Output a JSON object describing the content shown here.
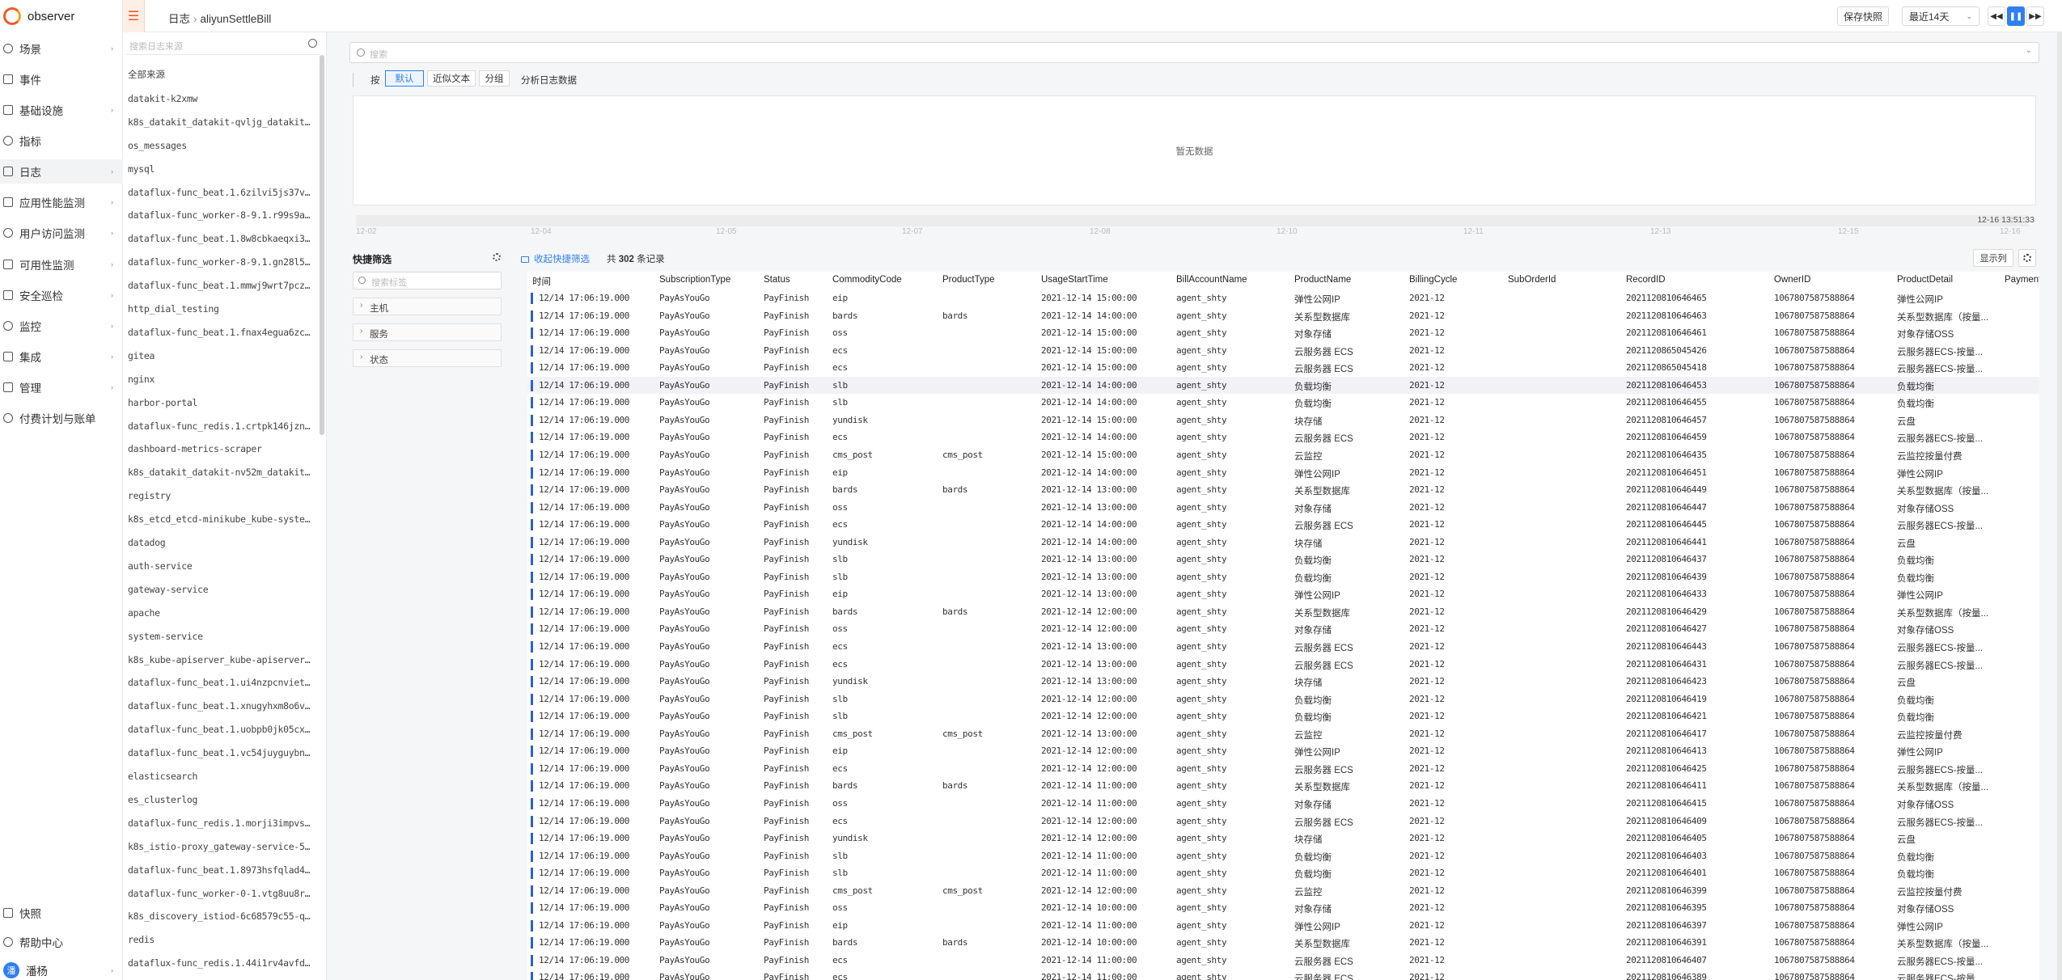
{
  "app": {
    "name": "observer"
  },
  "nav": {
    "items": [
      {
        "label": "场景",
        "arrow": true
      },
      {
        "label": "事件",
        "arrow": false
      },
      {
        "label": "基础设施",
        "arrow": true
      },
      {
        "label": "指标",
        "arrow": false
      },
      {
        "label": "日志",
        "arrow": true
      },
      {
        "label": "应用性能监测",
        "arrow": true
      },
      {
        "label": "用户访问监测",
        "arrow": true
      },
      {
        "label": "可用性监测",
        "arrow": true
      },
      {
        "label": "安全巡检",
        "arrow": true
      },
      {
        "label": "监控",
        "arrow": true
      },
      {
        "label": "集成",
        "arrow": true
      },
      {
        "label": "管理",
        "arrow": true
      },
      {
        "label": "付费计划与账单",
        "arrow": false
      }
    ],
    "bottom": [
      {
        "label": "快照"
      },
      {
        "label": "帮助中心"
      }
    ],
    "user": {
      "avatar": "潘",
      "name": "潘杨"
    }
  },
  "topbar": {
    "breadcrumb": [
      "日志",
      "aliyunSettleBill"
    ],
    "save_snapshot": "保存快照",
    "time_range": "最近14天"
  },
  "sources": {
    "search_placeholder": "搜索日志来源",
    "items": [
      "全部来源",
      "datakit-k2xmw",
      "k8s_datakit_datakit-qvljg_datakit_...",
      "os_messages",
      "mysql",
      "dataflux-func_beat.1.6zilvi5js37vg...",
      "dataflux-func_worker-8-9.1.r99s9a3...",
      "dataflux-func_beat.1.8w8cbkaeqxi37...",
      "dataflux-func_worker-8-9.1.gn28l5u...",
      "dataflux-func_beat.1.mmwj9wrt7pczl...",
      "http_dial_testing",
      "dataflux-func_beat.1.fnax4egua6zcw...",
      "gitea",
      "nginx",
      "harbor-portal",
      "dataflux-func_redis.1.crtpk146jzny...",
      "dashboard-metrics-scraper",
      "k8s_datakit_datakit-nv52m_datakit_...",
      "registry",
      "k8s_etcd_etcd-minikube_kube-system...",
      "datadog",
      "auth-service",
      "gateway-service",
      "apache",
      "system-service",
      "k8s_kube-apiserver_kube-apiserver-...",
      "dataflux-func_beat.1.ui4nzpcnvieth...",
      "dataflux-func_beat.1.xnugyhxm8o6vr...",
      "dataflux-func_beat.1.uobpb0jk05cx1...",
      "dataflux-func_beat.1.vc54juyguybne...",
      "elasticsearch",
      "es_clusterlog",
      "dataflux-func_redis.1.morji3impvsw...",
      "k8s_istio-proxy_gateway-service-59...",
      "dataflux-func_beat.1.8973hsfqlad4c...",
      "dataflux-func_worker-0-1.vtg8uu8r0...",
      "k8s_discovery_istiod-6c68579c55-qp...",
      "redis",
      "dataflux-func_redis.1.44i1rv4avfdl..."
    ]
  },
  "search": {
    "placeholder": "搜索"
  },
  "group": {
    "prefix": "按",
    "options": [
      "默认",
      "近似文本",
      "分组"
    ],
    "active": "默认",
    "analysis": "分析日志数据"
  },
  "chart": {
    "empty_text": "暂无数据",
    "ticks": [
      "12-02",
      "12-04",
      "12-05",
      "12-07",
      "12-08",
      "12-10",
      "12-11",
      "12-13",
      "12-15",
      "12-16"
    ],
    "current_time": "12-16 13:51:33"
  },
  "quick_filter": {
    "title": "快捷筛选",
    "search_placeholder": "搜索标签",
    "groups": [
      "主机",
      "服务",
      "状态"
    ]
  },
  "table": {
    "collapse_label": "收起快捷筛选",
    "total_prefix": "共",
    "total_count": "302",
    "total_suffix": "条记录",
    "columns_button": "显示列",
    "columns": [
      "时间",
      "SubscriptionType",
      "Status",
      "CommodityCode",
      "ProductType",
      "UsageStartTime",
      "BillAccountName",
      "ProductName",
      "BillingCycle",
      "SubOrderId",
      "RecordID",
      "OwnerID",
      "ProductDetail",
      "Payment"
    ],
    "rows": [
      [
        "12/14 17:06:19.000",
        "PayAsYouGo",
        "PayFinish",
        "eip",
        "",
        "2021-12-14 15:00:00",
        "agent_shty",
        "弹性公网IP",
        "2021-12",
        "",
        "2021120810646465",
        "1067807587588864",
        "弹性公网IP"
      ],
      [
        "12/14 17:06:19.000",
        "PayAsYouGo",
        "PayFinish",
        "bards",
        "bards",
        "2021-12-14 14:00:00",
        "agent_shty",
        "关系型数据库",
        "2021-12",
        "",
        "2021120810646463",
        "1067807587588864",
        "关系型数据库（按量..."
      ],
      [
        "12/14 17:06:19.000",
        "PayAsYouGo",
        "PayFinish",
        "oss",
        "",
        "2021-12-14 15:00:00",
        "agent_shty",
        "对象存储",
        "2021-12",
        "",
        "2021120810646461",
        "1067807587588864",
        "对象存储OSS"
      ],
      [
        "12/14 17:06:19.000",
        "PayAsYouGo",
        "PayFinish",
        "ecs",
        "",
        "2021-12-14 15:00:00",
        "agent_shty",
        "云服务器 ECS",
        "2021-12",
        "",
        "2021120865045426",
        "1067807587588864",
        "云服务器ECS-按量..."
      ],
      [
        "12/14 17:06:19.000",
        "PayAsYouGo",
        "PayFinish",
        "ecs",
        "",
        "2021-12-14 15:00:00",
        "agent_shty",
        "云服务器 ECS",
        "2021-12",
        "",
        "2021120865045418",
        "1067807587588864",
        "云服务器ECS-按量..."
      ],
      [
        "12/14 17:06:19.000",
        "PayAsYouGo",
        "PayFinish",
        "slb",
        "",
        "2021-12-14 14:00:00",
        "agent_shty",
        "负载均衡",
        "2021-12",
        "",
        "2021120810646453",
        "1067807587588864",
        "负载均衡"
      ],
      [
        "12/14 17:06:19.000",
        "PayAsYouGo",
        "PayFinish",
        "slb",
        "",
        "2021-12-14 14:00:00",
        "agent_shty",
        "负载均衡",
        "2021-12",
        "",
        "2021120810646455",
        "1067807587588864",
        "负载均衡"
      ],
      [
        "12/14 17:06:19.000",
        "PayAsYouGo",
        "PayFinish",
        "yundisk",
        "",
        "2021-12-14 15:00:00",
        "agent_shty",
        "块存储",
        "2021-12",
        "",
        "2021120810646457",
        "1067807587588864",
        "云盘"
      ],
      [
        "12/14 17:06:19.000",
        "PayAsYouGo",
        "PayFinish",
        "ecs",
        "",
        "2021-12-14 14:00:00",
        "agent_shty",
        "云服务器 ECS",
        "2021-12",
        "",
        "2021120810646459",
        "1067807587588864",
        "云服务器ECS-按量..."
      ],
      [
        "12/14 17:06:19.000",
        "PayAsYouGo",
        "PayFinish",
        "cms_post",
        "cms_post",
        "2021-12-14 15:00:00",
        "agent_shty",
        "云监控",
        "2021-12",
        "",
        "2021120810646435",
        "1067807587588864",
        "云监控按量付费"
      ],
      [
        "12/14 17:06:19.000",
        "PayAsYouGo",
        "PayFinish",
        "eip",
        "",
        "2021-12-14 14:00:00",
        "agent_shty",
        "弹性公网IP",
        "2021-12",
        "",
        "2021120810646451",
        "1067807587588864",
        "弹性公网IP"
      ],
      [
        "12/14 17:06:19.000",
        "PayAsYouGo",
        "PayFinish",
        "bards",
        "bards",
        "2021-12-14 13:00:00",
        "agent_shty",
        "关系型数据库",
        "2021-12",
        "",
        "2021120810646449",
        "1067807587588864",
        "关系型数据库（按量..."
      ],
      [
        "12/14 17:06:19.000",
        "PayAsYouGo",
        "PayFinish",
        "oss",
        "",
        "2021-12-14 13:00:00",
        "agent_shty",
        "对象存储",
        "2021-12",
        "",
        "2021120810646447",
        "1067807587588864",
        "对象存储OSS"
      ],
      [
        "12/14 17:06:19.000",
        "PayAsYouGo",
        "PayFinish",
        "ecs",
        "",
        "2021-12-14 14:00:00",
        "agent_shty",
        "云服务器 ECS",
        "2021-12",
        "",
        "2021120810646445",
        "1067807587588864",
        "云服务器ECS-按量..."
      ],
      [
        "12/14 17:06:19.000",
        "PayAsYouGo",
        "PayFinish",
        "yundisk",
        "",
        "2021-12-14 14:00:00",
        "agent_shty",
        "块存储",
        "2021-12",
        "",
        "2021120810646441",
        "1067807587588864",
        "云盘"
      ],
      [
        "12/14 17:06:19.000",
        "PayAsYouGo",
        "PayFinish",
        "slb",
        "",
        "2021-12-14 13:00:00",
        "agent_shty",
        "负载均衡",
        "2021-12",
        "",
        "2021120810646437",
        "1067807587588864",
        "负载均衡"
      ],
      [
        "12/14 17:06:19.000",
        "PayAsYouGo",
        "PayFinish",
        "slb",
        "",
        "2021-12-14 13:00:00",
        "agent_shty",
        "负载均衡",
        "2021-12",
        "",
        "2021120810646439",
        "1067807587588864",
        "负载均衡"
      ],
      [
        "12/14 17:06:19.000",
        "PayAsYouGo",
        "PayFinish",
        "eip",
        "",
        "2021-12-14 13:00:00",
        "agent_shty",
        "弹性公网IP",
        "2021-12",
        "",
        "2021120810646433",
        "1067807587588864",
        "弹性公网IP"
      ],
      [
        "12/14 17:06:19.000",
        "PayAsYouGo",
        "PayFinish",
        "bards",
        "bards",
        "2021-12-14 12:00:00",
        "agent_shty",
        "关系型数据库",
        "2021-12",
        "",
        "2021120810646429",
        "1067807587588864",
        "关系型数据库（按量..."
      ],
      [
        "12/14 17:06:19.000",
        "PayAsYouGo",
        "PayFinish",
        "oss",
        "",
        "2021-12-14 12:00:00",
        "agent_shty",
        "对象存储",
        "2021-12",
        "",
        "2021120810646427",
        "1067807587588864",
        "对象存储OSS"
      ],
      [
        "12/14 17:06:19.000",
        "PayAsYouGo",
        "PayFinish",
        "ecs",
        "",
        "2021-12-14 13:00:00",
        "agent_shty",
        "云服务器 ECS",
        "2021-12",
        "",
        "2021120810646443",
        "1067807587588864",
        "云服务器ECS-按量..."
      ],
      [
        "12/14 17:06:19.000",
        "PayAsYouGo",
        "PayFinish",
        "ecs",
        "",
        "2021-12-14 13:00:00",
        "agent_shty",
        "云服务器 ECS",
        "2021-12",
        "",
        "2021120810646431",
        "1067807587588864",
        "云服务器ECS-按量..."
      ],
      [
        "12/14 17:06:19.000",
        "PayAsYouGo",
        "PayFinish",
        "yundisk",
        "",
        "2021-12-14 13:00:00",
        "agent_shty",
        "块存储",
        "2021-12",
        "",
        "2021120810646423",
        "1067807587588864",
        "云盘"
      ],
      [
        "12/14 17:06:19.000",
        "PayAsYouGo",
        "PayFinish",
        "slb",
        "",
        "2021-12-14 12:00:00",
        "agent_shty",
        "负载均衡",
        "2021-12",
        "",
        "2021120810646419",
        "1067807587588864",
        "负载均衡"
      ],
      [
        "12/14 17:06:19.000",
        "PayAsYouGo",
        "PayFinish",
        "slb",
        "",
        "2021-12-14 12:00:00",
        "agent_shty",
        "负载均衡",
        "2021-12",
        "",
        "2021120810646421",
        "1067807587588864",
        "负载均衡"
      ],
      [
        "12/14 17:06:19.000",
        "PayAsYouGo",
        "PayFinish",
        "cms_post",
        "cms_post",
        "2021-12-14 13:00:00",
        "agent_shty",
        "云监控",
        "2021-12",
        "",
        "2021120810646417",
        "1067807587588864",
        "云监控按量付费"
      ],
      [
        "12/14 17:06:19.000",
        "PayAsYouGo",
        "PayFinish",
        "eip",
        "",
        "2021-12-14 12:00:00",
        "agent_shty",
        "弹性公网IP",
        "2021-12",
        "",
        "2021120810646413",
        "1067807587588864",
        "弹性公网IP"
      ],
      [
        "12/14 17:06:19.000",
        "PayAsYouGo",
        "PayFinish",
        "ecs",
        "",
        "2021-12-14 12:00:00",
        "agent_shty",
        "云服务器 ECS",
        "2021-12",
        "",
        "2021120810646425",
        "1067807587588864",
        "云服务器ECS-按量..."
      ],
      [
        "12/14 17:06:19.000",
        "PayAsYouGo",
        "PayFinish",
        "bards",
        "bards",
        "2021-12-14 11:00:00",
        "agent_shty",
        "关系型数据库",
        "2021-12",
        "",
        "2021120810646411",
        "1067807587588864",
        "关系型数据库（按量..."
      ],
      [
        "12/14 17:06:19.000",
        "PayAsYouGo",
        "PayFinish",
        "oss",
        "",
        "2021-12-14 11:00:00",
        "agent_shty",
        "对象存储",
        "2021-12",
        "",
        "2021120810646415",
        "1067807587588864",
        "对象存储OSS"
      ],
      [
        "12/14 17:06:19.000",
        "PayAsYouGo",
        "PayFinish",
        "ecs",
        "",
        "2021-12-14 12:00:00",
        "agent_shty",
        "云服务器 ECS",
        "2021-12",
        "",
        "2021120810646409",
        "1067807587588864",
        "云服务器ECS-按量..."
      ],
      [
        "12/14 17:06:19.000",
        "PayAsYouGo",
        "PayFinish",
        "yundisk",
        "",
        "2021-12-14 12:00:00",
        "agent_shty",
        "块存储",
        "2021-12",
        "",
        "2021120810646405",
        "1067807587588864",
        "云盘"
      ],
      [
        "12/14 17:06:19.000",
        "PayAsYouGo",
        "PayFinish",
        "slb",
        "",
        "2021-12-14 11:00:00",
        "agent_shty",
        "负载均衡",
        "2021-12",
        "",
        "2021120810646403",
        "1067807587588864",
        "负载均衡"
      ],
      [
        "12/14 17:06:19.000",
        "PayAsYouGo",
        "PayFinish",
        "slb",
        "",
        "2021-12-14 11:00:00",
        "agent_shty",
        "负载均衡",
        "2021-12",
        "",
        "2021120810646401",
        "1067807587588864",
        "负载均衡"
      ],
      [
        "12/14 17:06:19.000",
        "PayAsYouGo",
        "PayFinish",
        "cms_post",
        "cms_post",
        "2021-12-14 12:00:00",
        "agent_shty",
        "云监控",
        "2021-12",
        "",
        "2021120810646399",
        "1067807587588864",
        "云监控按量付费"
      ],
      [
        "12/14 17:06:19.000",
        "PayAsYouGo",
        "PayFinish",
        "oss",
        "",
        "2021-12-14 10:00:00",
        "agent_shty",
        "对象存储",
        "2021-12",
        "",
        "2021120810646395",
        "1067807587588864",
        "对象存储OSS"
      ],
      [
        "12/14 17:06:19.000",
        "PayAsYouGo",
        "PayFinish",
        "eip",
        "",
        "2021-12-14 11:00:00",
        "agent_shty",
        "弹性公网IP",
        "2021-12",
        "",
        "2021120810646397",
        "1067807587588864",
        "弹性公网IP"
      ],
      [
        "12/14 17:06:19.000",
        "PayAsYouGo",
        "PayFinish",
        "bards",
        "bards",
        "2021-12-14 10:00:00",
        "agent_shty",
        "关系型数据库",
        "2021-12",
        "",
        "2021120810646391",
        "1067807587588864",
        "关系型数据库（按量..."
      ],
      [
        "12/14 17:06:19.000",
        "PayAsYouGo",
        "PayFinish",
        "ecs",
        "",
        "2021-12-14 11:00:00",
        "agent_shty",
        "云服务器 ECS",
        "2021-12",
        "",
        "2021120810646407",
        "1067807587588864",
        "云服务器ECS-按量..."
      ],
      [
        "12/14 17:06:19.000",
        "PayAsYouGo",
        "PayFinish",
        "ecs",
        "",
        "2021-12-14 11:00:00",
        "agent_shty",
        "云服务器 ECS",
        "2021-12",
        "",
        "2021120810646389",
        "1067807587588864",
        "云服务器ECS-按量..."
      ]
    ]
  }
}
